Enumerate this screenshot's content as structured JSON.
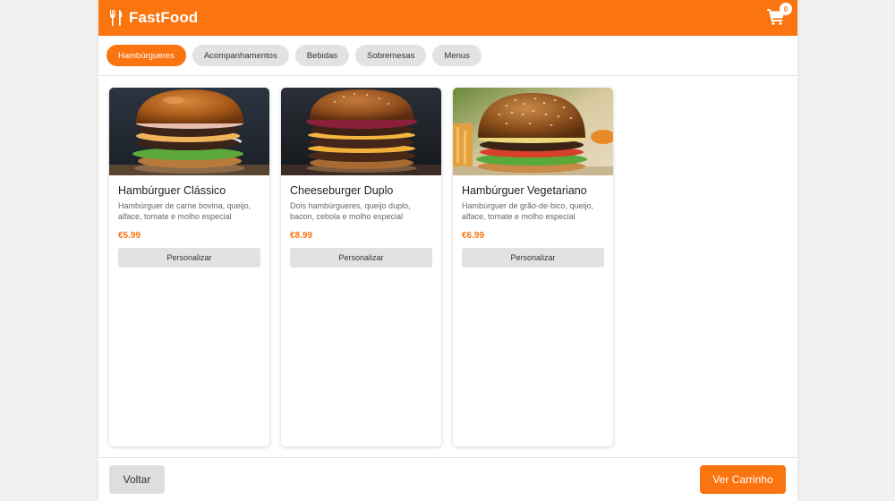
{
  "header": {
    "brand_name": "FastFood",
    "brand_icon": "fork-knife-icon",
    "cart_icon": "cart-icon",
    "cart_count": "0",
    "accent_color": "#fa7410"
  },
  "categories": [
    {
      "label": "Hambúrgueres",
      "active": true
    },
    {
      "label": "Acompanhamentos",
      "active": false
    },
    {
      "label": "Bebidas",
      "active": false
    },
    {
      "label": "Sobremesas",
      "active": false
    },
    {
      "label": "Menus",
      "active": false
    }
  ],
  "products": [
    {
      "name": "Hambúrguer Clássico",
      "description": "Hambúrguer de carne bovina, queijo, alface, tomate e molho especial",
      "price": "€5.99",
      "button_label": "Personalizar"
    },
    {
      "name": "Cheeseburger Duplo",
      "description": "Dois hambúrgueres, queijo duplo, bacon, cebola e molho especial",
      "price": "€8.99",
      "button_label": "Personalizar"
    },
    {
      "name": "Hambúrguer Vegetariano",
      "description": "Hambúrguer de grão-de-bico, queijo, alface, tomate e molho especial",
      "price": "€6.99",
      "button_label": "Personalizar"
    }
  ],
  "footer": {
    "back_label": "Voltar",
    "cart_label": "Ver Carrinho"
  }
}
